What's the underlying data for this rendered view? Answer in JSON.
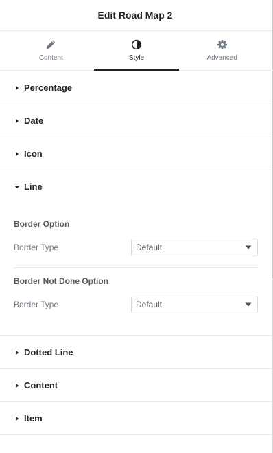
{
  "header": {
    "title": "Edit Road Map 2"
  },
  "tabs": [
    {
      "label": "Content",
      "icon": "pencil-icon",
      "active": false
    },
    {
      "label": "Style",
      "icon": "contrast-icon",
      "active": true
    },
    {
      "label": "Advanced",
      "icon": "gear-icon",
      "active": false
    }
  ],
  "sections": {
    "percentage": {
      "title": "Percentage"
    },
    "date": {
      "title": "Date"
    },
    "icon": {
      "title": "Icon"
    },
    "line": {
      "title": "Line",
      "border_option": {
        "heading": "Border Option",
        "label": "Border Type",
        "value": "Default"
      },
      "border_not_done": {
        "heading": "Border Not Done Option",
        "label": "Border Type",
        "value": "Default"
      }
    },
    "dotted_line": {
      "title": "Dotted Line"
    },
    "content": {
      "title": "Content"
    },
    "item": {
      "title": "Item"
    }
  },
  "colors": {
    "text": "#1f2124",
    "muted": "#6d7882",
    "border": "#e6e8ea",
    "active_tab_underline": "#1f2124"
  }
}
